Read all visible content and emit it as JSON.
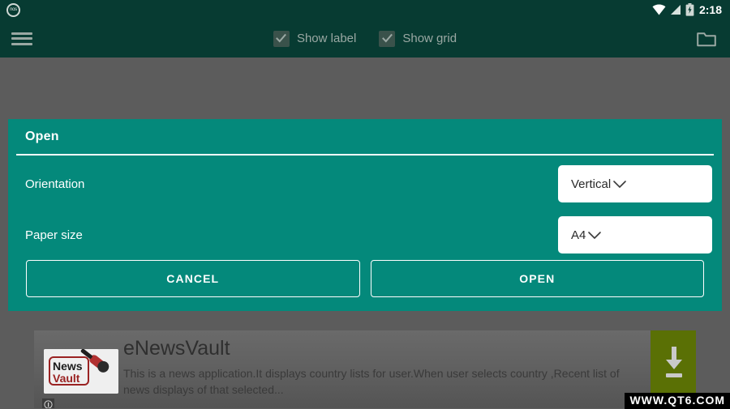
{
  "status_bar": {
    "notification_icon_label": "nos",
    "icons": [
      "wifi-icon",
      "signal-icon",
      "battery-charging-icon"
    ],
    "time": "2:18"
  },
  "toolbar": {
    "menu_icon": "hamburger-menu-icon",
    "folder_icon": "folder-icon",
    "checkboxes": [
      {
        "label": "Show label",
        "checked": true
      },
      {
        "label": "Show grid",
        "checked": true
      }
    ]
  },
  "dialog": {
    "title": "Open",
    "rows": [
      {
        "label": "Orientation",
        "value": "Vertical",
        "icon": "chevron-down-icon"
      },
      {
        "label": "Paper size",
        "value": "A4",
        "icon": "chevron-down-icon"
      }
    ],
    "buttons": [
      {
        "label": "CANCEL"
      },
      {
        "label": "OPEN"
      }
    ]
  },
  "ad": {
    "logo_text_line1": "News",
    "logo_text_line2": "Vault",
    "title": "eNewsVault",
    "description": "This is a news application.It displays country lists for user.When user selects country ,Recent list of news displays of that selected...",
    "download_icon": "download-arrow-icon",
    "info_icon": "ad-info-icon"
  },
  "watermark": {
    "text": "WWW.QT6.COM"
  },
  "colors": {
    "status_bar": "#073b32",
    "toolbar": "#073b32",
    "scrim": "#5c5c5c",
    "dialog": "#04897b",
    "dialog_text": "#ffffff",
    "dropdown_bg": "#ffffff",
    "dropdown_text": "#2a2a2a",
    "checkbox_label": "#9aa8a3",
    "download_button": "#5a7005",
    "watermark_bg": "#000000"
  }
}
